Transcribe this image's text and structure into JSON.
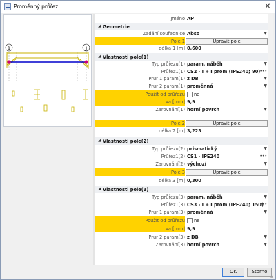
{
  "window": {
    "title": "Proměnný průřez",
    "close_glyph": "✕"
  },
  "preview": {
    "node_left": "i",
    "node_right": "j",
    "colors": {
      "beam": "#c8b200",
      "member": "#0000cc",
      "node": "#cc0077",
      "section": "#c8b200"
    }
  },
  "props": {
    "name": {
      "label": "Jméno",
      "value": "AP"
    },
    "geometry": {
      "header": "Geometrie",
      "input_label": "Zadání souřadnice",
      "input_value": "Abso",
      "pole1_label": "Pole 1",
      "pole1_button": "Upravit pole",
      "length1_label": "délka 1 [m]",
      "length1_value": "0,600"
    },
    "field1": {
      "header": "Vlastnosti pole(1)",
      "type_label": "Typ průřezu(1)",
      "type_value": "param. náběh",
      "section_label": "Průřez1(1)",
      "section_value": "CS2 - I + I prom (IPE240; 90)",
      "prur1_label": "Prur 1 param(1)",
      "prur1_value": "z DB",
      "prur2_label": "Prur 2 param(1)",
      "prur2_value": "proměnná",
      "use_label": "Použít od průřezu",
      "use_value": "ne",
      "va_label": "va [mm]",
      "va_value": "9,9",
      "align_label": "Zarovnání(1)",
      "align_value": "horní povrch",
      "pole2_label": "Pole 2",
      "pole2_button": "Upravit pole",
      "length2_label": "délka 2 [m]",
      "length2_value": "3,223"
    },
    "field2": {
      "header": "Vlastnosti pole(2)",
      "type_label": "Typ průřezu(2)",
      "type_value": "prismatický",
      "section_label": "Průřez1(2)",
      "section_value": "CS1 - IPE240",
      "align_label": "Zarovnání(2)",
      "align_value": "výchozí",
      "pole3_label": "Pole 3",
      "pole3_button": "Upravit pole",
      "length3_label": "délka 3 [m]",
      "length3_value": "0,300"
    },
    "field3": {
      "header": "Vlastnosti pole(3)",
      "type_label": "Typ průřezu(3)",
      "type_value": "param. náběh",
      "section_label": "Průřez1(3)",
      "section_value": "CS3 - I + I prom (IPE240; 150)",
      "prur1_label": "Prur 1 param(3)",
      "prur1_value": "proměnná",
      "use_label": "Použít od průřezu",
      "use_value": "ne",
      "va_label": "va [mm]",
      "va_value": "9,9",
      "prur2_label": "Prur 2 param(3)",
      "prur2_value": "z DB",
      "align_label": "Zarovnání(3)",
      "align_value": "horní povrch"
    }
  },
  "footer": {
    "ok": "OK",
    "cancel": "Storno"
  }
}
